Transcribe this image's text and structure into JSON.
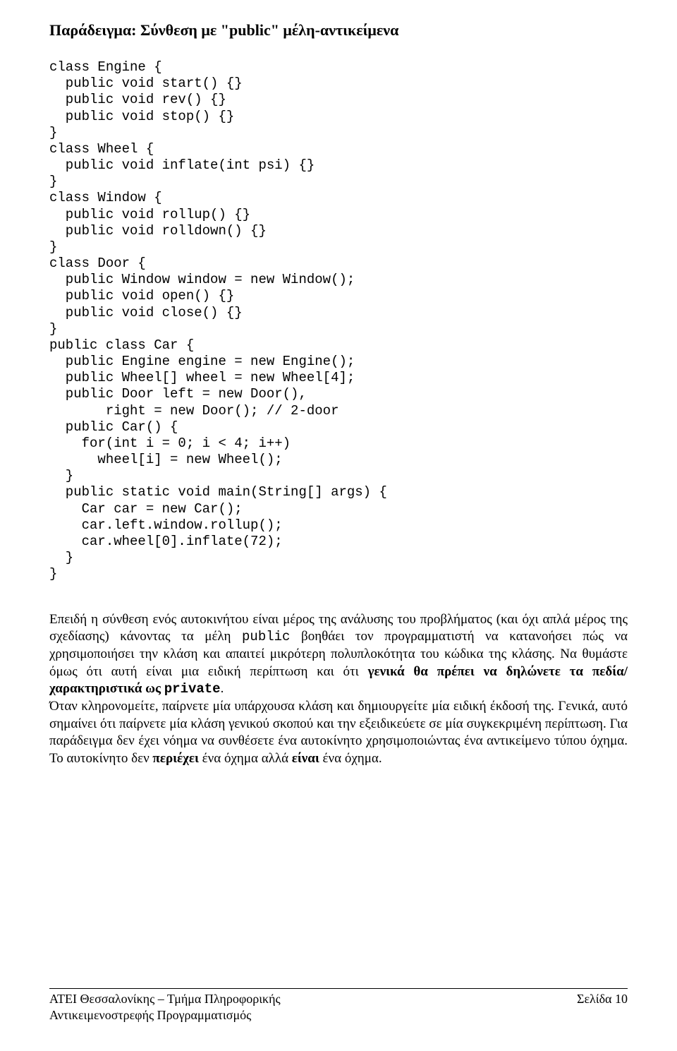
{
  "heading": "Παράδειγμα: Σύνθεση με \"public\" μέλη-αντικείμενα",
  "code": "class Engine {\n  public void start() {}\n  public void rev() {}\n  public void stop() {}\n}\nclass Wheel {\n  public void inflate(int psi) {}\n}\nclass Window {\n  public void rollup() {}\n  public void rolldown() {}\n}\nclass Door {\n  public Window window = new Window();\n  public void open() {}\n  public void close() {}\n}\npublic class Car {\n  public Engine engine = new Engine();\n  public Wheel[] wheel = new Wheel[4];\n  public Door left = new Door(),\n       right = new Door(); // 2-door\n  public Car() {\n    for(int i = 0; i < 4; i++)\n      wheel[i] = new Wheel();\n  }\n  public static void main(String[] args) {\n    Car car = new Car();\n    car.left.window.rollup();\n    car.wheel[0].inflate(72);\n  }\n}",
  "prose": {
    "p1_a": "Επειδή η σύνθεση ενός αυτοκινήτου είναι μέρος της ανάλυσης του προβλήματος (και όχι απλά μέρος της σχεδίασης) κάνοντας τα μέλη ",
    "p1_code1": "public",
    "p1_b": " βοηθάει τον προγραμματιστή να κατανοήσει πώς να χρησιμοποιήσει την κλάση και απαιτεί μικρότερη πολυπλοκότητα του κώδικα της κλάσης. Να θυμάστε όμως ότι αυτή είναι μια ειδική περίπτωση και ότι ",
    "p1_bold1": "γενικά θα πρέπει να δηλώνετε τα πεδία/χαρακτηριστικά ως ",
    "p1_code2": "private",
    "p1_c": ".",
    "p2_a": "Όταν κληρονομείτε, παίρνετε μία υπάρχουσα κλάση και δημιουργείτε μία ειδική έκδοσή της. Γενικά, αυτό σημαίνει ότι παίρνετε μία κλάση γενικού σκοπού και την εξειδικεύετε σε μία συγκεκριμένη περίπτωση. Για παράδειγμα δεν έχει νόημα να συνθέσετε ένα αυτοκίνητο χρησιμοποιώντας ένα αντικείμενο τύπου όχημα. Το αυτοκίνητο δεν ",
    "p2_bold1": "περιέχει",
    "p2_b": " ένα όχημα αλλά ",
    "p2_bold2": "είναι",
    "p2_c": " ένα όχημα."
  },
  "footer": {
    "left_line1": "ΑΤΕΙ Θεσσαλονίκης – Τμήμα Πληροφορικής",
    "left_line2": "Αντικειμενοστρεφής Προγραμματισμός",
    "right": "Σελίδα 10"
  }
}
